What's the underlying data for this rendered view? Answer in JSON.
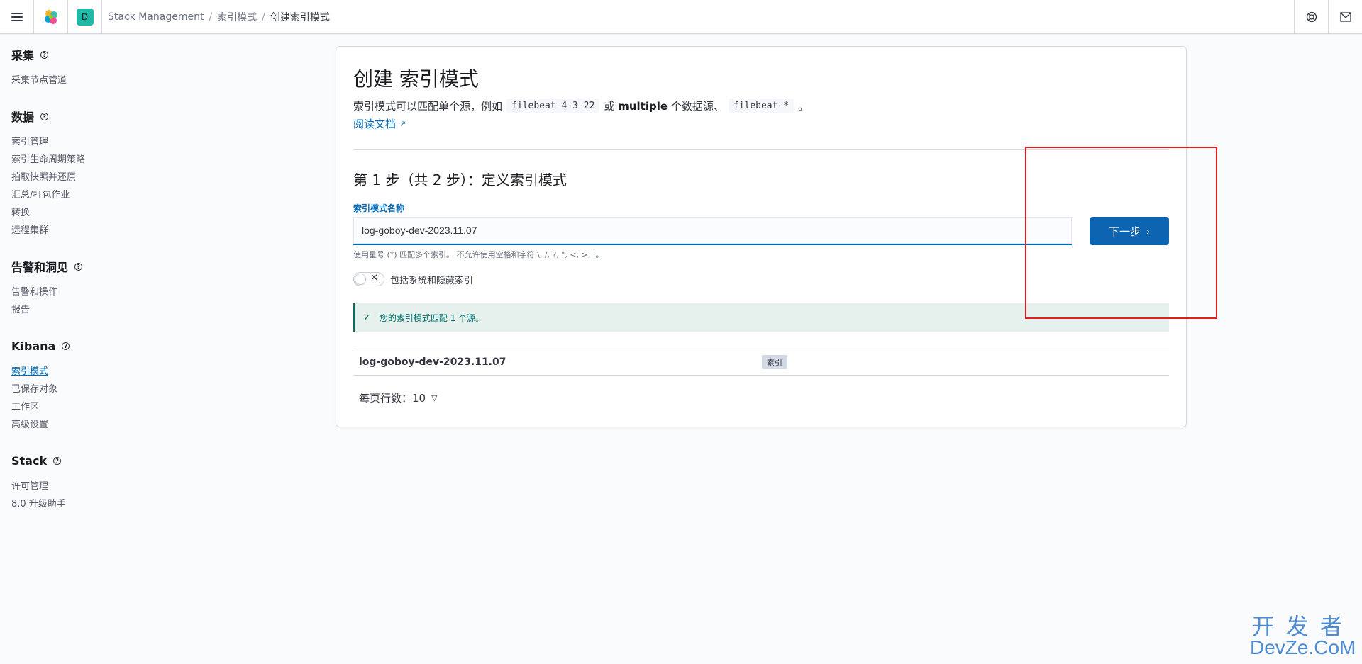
{
  "header": {
    "avatar_letter": "D",
    "breadcrumbs": [
      "Stack Management",
      "索引模式",
      "创建索引模式"
    ]
  },
  "sidebar": {
    "sections": [
      {
        "title": "采集",
        "items": [
          "采集节点管道"
        ]
      },
      {
        "title": "数据",
        "items": [
          "索引管理",
          "索引生命周期策略",
          "拍取快照并还原",
          "汇总/打包作业",
          "转换",
          "远程集群"
        ]
      },
      {
        "title": "告警和洞见",
        "items": [
          "告警和操作",
          "报告"
        ]
      },
      {
        "title": "Kibana",
        "items": [
          "索引模式",
          "已保存对象",
          "工作区",
          "高级设置"
        ]
      },
      {
        "title": "Stack",
        "items": [
          "许可管理",
          "8.0 升级助手"
        ]
      }
    ],
    "active_item": "索引模式"
  },
  "main": {
    "title": "创建 索引模式",
    "desc_prefix": "索引模式可以匹配单个源，例如",
    "example_single": "filebeat-4-3-22",
    "desc_or": "或",
    "desc_multiple": "multiple",
    "desc_sources": "个数据源、",
    "example_multi": "filebeat-*",
    "desc_end": "。",
    "doc_link": "阅读文档",
    "step_title": "第 1 步（共 2 步）：定义索引模式",
    "field_label": "索引模式名称",
    "input_value": "log-goboy-dev-2023.11.07",
    "next_button": "下一步",
    "help_text": "使用星号 (*) 匹配多个索引。 不允许使用空格和字符 \\, /, ?, \", <, >, |。",
    "toggle_label": "包括系统和隐藏索引",
    "callout": "您的索引模式匹配 1 个源。",
    "results": [
      {
        "name": "log-goboy-dev-2023.11.07",
        "badge": "索引"
      }
    ],
    "rows_per_page_label": "每页行数：10"
  },
  "watermark": {
    "line1": "开发者",
    "line2": "DevZe.CoM"
  },
  "colors": {
    "primary": "#0d64b0",
    "link": "#006bb8",
    "success": "#00726b",
    "annotation": "#e31c1c"
  }
}
